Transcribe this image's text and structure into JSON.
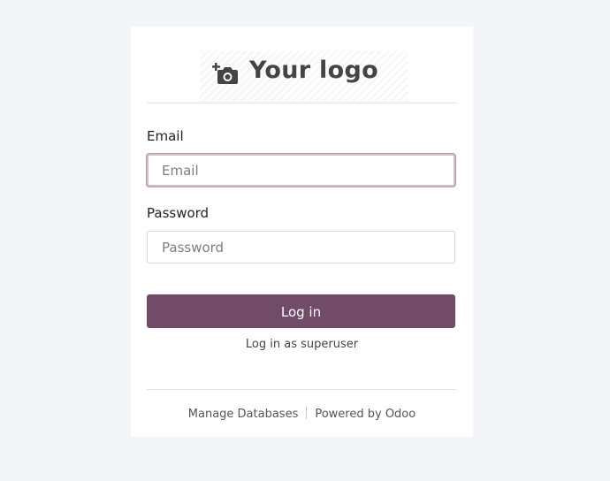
{
  "logo": {
    "text": "Your logo",
    "icon": "camera-add-icon"
  },
  "form": {
    "email_label": "Email",
    "email_placeholder": "Email",
    "email_value": "",
    "password_label": "Password",
    "password_placeholder": "Password",
    "password_value": "",
    "login_button": "Log in",
    "superuser_link": "Log in as superuser"
  },
  "footer": {
    "manage_databases": "Manage Databases",
    "powered_by": "Powered by Odoo"
  },
  "colors": {
    "brand": "#714b67",
    "background": "#f4f5f8",
    "card": "#ffffff"
  }
}
